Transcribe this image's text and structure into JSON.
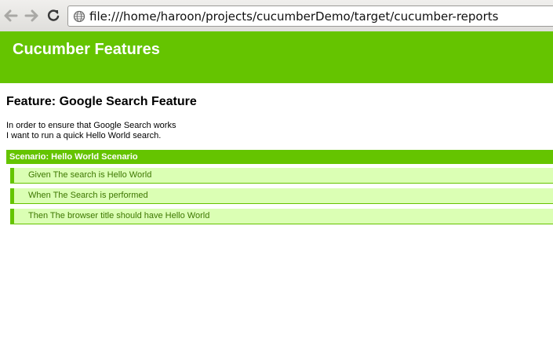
{
  "browser": {
    "url": "file:///home/haroon/projects/cucumberDemo/target/cucumber-reports"
  },
  "report": {
    "title": "Cucumber Features",
    "feature": {
      "heading": "Feature: Google Search Feature",
      "description": [
        "In order to ensure that Google Search works",
        "I want to run a quick Hello World search."
      ]
    },
    "scenario": {
      "title": "Scenario: Hello World Scenario",
      "steps": [
        "Given The search is Hello World",
        "When The Search is performed",
        "Then The browser title should have Hello World"
      ]
    }
  },
  "colors": {
    "accent_green": "#65c400",
    "step_bg": "#dbffb4",
    "step_text": "#3d7700"
  }
}
